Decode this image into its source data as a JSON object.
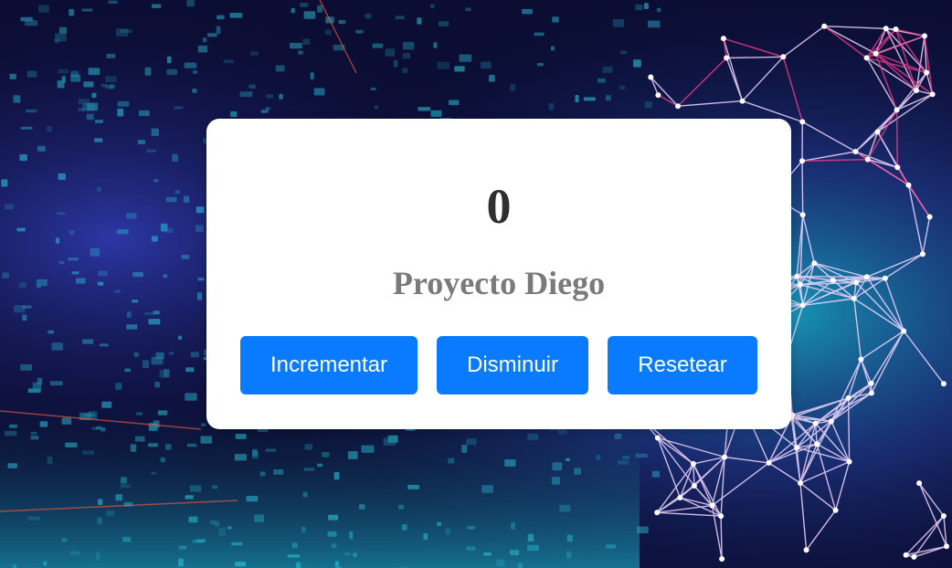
{
  "counter": {
    "value": "0"
  },
  "project": {
    "title": "Proyecto Diego"
  },
  "buttons": {
    "increment_label": "Incrementar",
    "decrement_label": "Disminuir",
    "reset_label": "Resetear"
  },
  "colors": {
    "button_bg": "#0a7bff",
    "card_bg": "#ffffff",
    "counter_text": "#2f2f2f",
    "title_text": "#7a7a7a",
    "background_dark": "#0a0b2e",
    "background_cyan": "#23d6e6",
    "background_magenta": "#e0307a"
  }
}
